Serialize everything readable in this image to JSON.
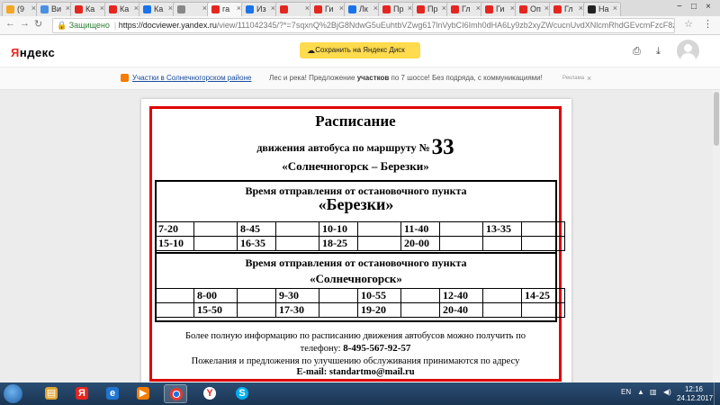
{
  "browser": {
    "tabs": [
      {
        "label": "(9",
        "color": "#f5a623"
      },
      {
        "label": "Ви",
        "color": "#4a90e2"
      },
      {
        "label": "Ка",
        "color": "#e52620"
      },
      {
        "label": "Ка",
        "color": "#e52620"
      },
      {
        "label": "Ка",
        "color": "#1a73e8"
      },
      {
        "label": "",
        "color": "#888888"
      },
      {
        "label": "га",
        "color": "#e52620"
      },
      {
        "label": "Из",
        "color": "#1a73e8"
      },
      {
        "label": "",
        "color": "#e52620"
      },
      {
        "label": "Ги",
        "color": "#e52620"
      },
      {
        "label": "Лк",
        "color": "#1a73e8"
      },
      {
        "label": "Пр",
        "color": "#e52620"
      },
      {
        "label": "Пр",
        "color": "#e52620"
      },
      {
        "label": "Гл",
        "color": "#e52620"
      },
      {
        "label": "Ги",
        "color": "#e52620"
      },
      {
        "label": "Оп",
        "color": "#e52620"
      },
      {
        "label": "Гл",
        "color": "#e52620"
      },
      {
        "label": "На",
        "color": "#222222"
      }
    ],
    "address": {
      "secure_label": "Защищено",
      "host": "https://docviewer.yandex.ru",
      "path": "/view/111042345/?*=7sqxnQ%2BjG8NdwG5uEuhtbVZwg617lnVybCI6Imh0dHA6Ly9zb2xyZWcucnUvdXNlcmRhdGEvcmFzcF8zMy5wZGYiLCJ..."
    }
  },
  "viewer_header": {
    "logo_main": "Я",
    "logo_rest": "ндекс",
    "save_button": "Сохранить на Яндекс Диск",
    "print_icon": "printer-icon",
    "download_icon": "download-icon"
  },
  "ad": {
    "link": "Участки в Солнечногорском районе",
    "text_before": "Лес и река! Предложение ",
    "text_bold": "участков",
    "text_after": " по 7 шоссе! Без подряда, с коммуникациями!",
    "mark": "Реклама",
    "close": "×"
  },
  "document": {
    "title": "Расписание",
    "subtitle": "движения автобуса по маршруту №",
    "route_number": "33",
    "route_name": "«Солнечногорск – Березки»",
    "section1": {
      "heading": "Время отправления от остановочного пункта",
      "stop": "«Березки»",
      "rows": [
        [
          "7-20",
          "",
          "8-45",
          "",
          "10-10",
          "",
          "11-40",
          "",
          "13-35",
          ""
        ],
        [
          "15-10",
          "",
          "16-35",
          "",
          "18-25",
          "",
          "20-00",
          "",
          "",
          ""
        ]
      ]
    },
    "section2": {
      "heading": "Время отправления от остановочного пункта",
      "stop": "«Солнечногорск»",
      "rows": [
        [
          "",
          "8-00",
          "",
          "9-30",
          "",
          "10-55",
          "",
          "12-40",
          "",
          "14-25"
        ],
        [
          "",
          "15-50",
          "",
          "17-30",
          "",
          "19-20",
          "",
          "20-40",
          "",
          ""
        ]
      ]
    },
    "footer": {
      "line1": "Более полную информацию по расписанию движения автобусов можно получить по",
      "line2_prefix": "телефону: ",
      "phone": "8-495-567-92-57",
      "line3": "Пожелания и предложения по улучшению обслуживания принимаются по адресу",
      "email": "E-mail: standartmo@mail.ru"
    }
  },
  "taskbar": {
    "lang": "EN",
    "time": "12:16",
    "date": "24.12.2017"
  }
}
